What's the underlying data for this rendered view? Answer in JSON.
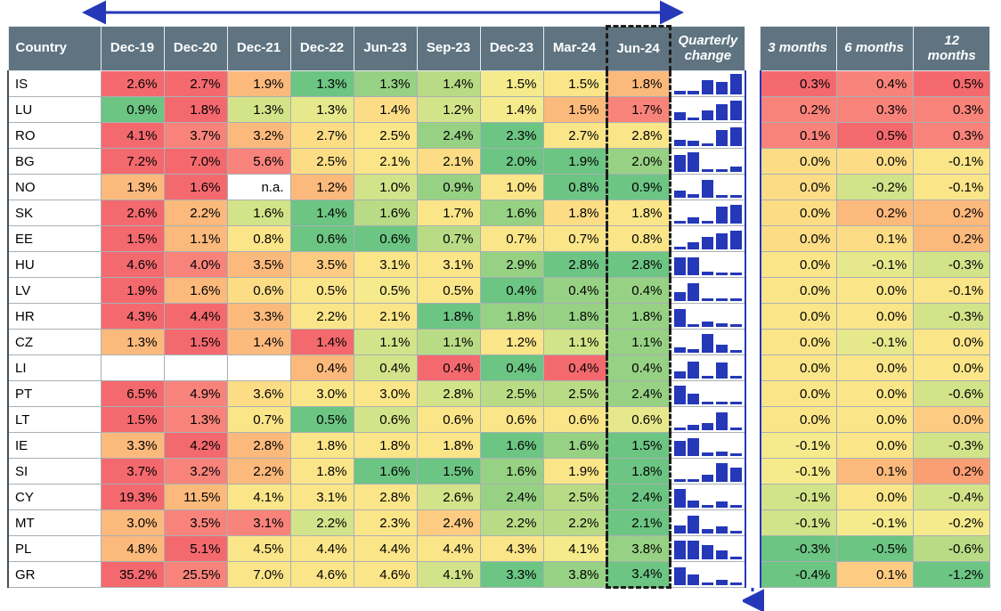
{
  "chart_data": {
    "type": "table",
    "title": "",
    "legend": "",
    "columns": [
      "Country",
      "Dec-19",
      "Dec-20",
      "Dec-21",
      "Dec-22",
      "Jun-23",
      "Sep-23",
      "Dec-23",
      "Mar-24",
      "Jun-24",
      "Quarterly change",
      "3 months",
      "6 months",
      "12 months"
    ],
    "highlighted_column": "Jun-24",
    "annotations": {
      "horizontal_arrow": "double-headed arrow spanning Dec-19 to Jun-24 columns",
      "vertical_arrow": "downward arrow along left edge of 3 months column",
      "arrow_color": "#2438b8"
    },
    "rows": [
      {
        "country": "IS",
        "values": [
          "2.6%",
          "2.7%",
          "1.9%",
          "1.3%",
          "1.3%",
          "1.4%",
          "1.5%",
          "1.5%",
          "1.8%"
        ],
        "spark": [
          4,
          4,
          16,
          14,
          23
        ],
        "changes": [
          "0.3%",
          "0.4%",
          "0.5%"
        ]
      },
      {
        "country": "LU",
        "values": [
          "0.9%",
          "1.8%",
          "1.3%",
          "1.3%",
          "1.4%",
          "1.2%",
          "1.4%",
          "1.5%",
          "1.7%"
        ],
        "spark": [
          9,
          3,
          11,
          18,
          22
        ],
        "changes": [
          "0.2%",
          "0.3%",
          "0.3%"
        ]
      },
      {
        "country": "RO",
        "values": [
          "4.1%",
          "3.7%",
          "3.2%",
          "2.7%",
          "2.5%",
          "2.4%",
          "2.3%",
          "2.7%",
          "2.8%"
        ],
        "spark": [
          7,
          6,
          3,
          18,
          21
        ],
        "changes": [
          "0.1%",
          "0.5%",
          "0.3%"
        ]
      },
      {
        "country": "BG",
        "values": [
          "7.2%",
          "7.0%",
          "5.6%",
          "2.5%",
          "2.1%",
          "2.1%",
          "2.0%",
          "1.9%",
          "2.0%"
        ],
        "spark": [
          19,
          22,
          3,
          3,
          6
        ],
        "changes": [
          "0.0%",
          "0.0%",
          "-0.1%"
        ]
      },
      {
        "country": "NO",
        "values": [
          "1.3%",
          "1.6%",
          "n.a.",
          "1.2%",
          "1.0%",
          "0.9%",
          "1.0%",
          "0.8%",
          "0.9%"
        ],
        "spark": [
          8,
          4,
          20,
          3,
          3
        ],
        "changes": [
          "0.0%",
          "-0.2%",
          "-0.1%"
        ]
      },
      {
        "country": "SK",
        "values": [
          "2.6%",
          "2.2%",
          "1.6%",
          "1.4%",
          "1.6%",
          "1.7%",
          "1.6%",
          "1.8%",
          "1.8%"
        ],
        "spark": [
          3,
          7,
          3,
          19,
          21
        ],
        "changes": [
          "0.0%",
          "0.2%",
          "0.2%"
        ]
      },
      {
        "country": "EE",
        "values": [
          "1.5%",
          "1.1%",
          "0.8%",
          "0.6%",
          "0.6%",
          "0.7%",
          "0.7%",
          "0.7%",
          "0.8%"
        ],
        "spark": [
          3,
          8,
          14,
          18,
          21
        ],
        "changes": [
          "0.0%",
          "0.1%",
          "0.2%"
        ]
      },
      {
        "country": "HU",
        "values": [
          "4.6%",
          "4.0%",
          "3.5%",
          "3.5%",
          "3.1%",
          "3.1%",
          "2.9%",
          "2.8%",
          "2.8%"
        ],
        "spark": [
          20,
          20,
          4,
          3,
          3
        ],
        "changes": [
          "0.0%",
          "-0.1%",
          "-0.3%"
        ]
      },
      {
        "country": "LV",
        "values": [
          "1.9%",
          "1.6%",
          "0.6%",
          "0.5%",
          "0.5%",
          "0.5%",
          "0.4%",
          "0.4%",
          "0.4%"
        ],
        "spark": [
          10,
          20,
          3,
          3,
          3
        ],
        "changes": [
          "0.0%",
          "0.0%",
          "-0.1%"
        ]
      },
      {
        "country": "HR",
        "values": [
          "4.3%",
          "4.4%",
          "3.3%",
          "2.2%",
          "2.1%",
          "1.8%",
          "1.8%",
          "1.8%",
          "1.8%"
        ],
        "spark": [
          20,
          3,
          6,
          4,
          3
        ],
        "changes": [
          "0.0%",
          "0.0%",
          "-0.3%"
        ]
      },
      {
        "country": "CZ",
        "values": [
          "1.3%",
          "1.5%",
          "1.4%",
          "1.4%",
          "1.1%",
          "1.1%",
          "1.2%",
          "1.1%",
          "1.1%"
        ],
        "spark": [
          6,
          4,
          21,
          9,
          3
        ],
        "changes": [
          "0.0%",
          "-0.1%",
          "0.0%"
        ]
      },
      {
        "country": "LI",
        "values": [
          "",
          "",
          "",
          "0.4%",
          "0.4%",
          "0.4%",
          "0.4%",
          "0.4%",
          "0.4%"
        ],
        "spark": [
          8,
          19,
          3,
          18,
          3
        ],
        "changes": [
          "0.0%",
          "0.0%",
          "0.0%"
        ]
      },
      {
        "country": "PT",
        "values": [
          "6.5%",
          "4.9%",
          "3.6%",
          "3.0%",
          "3.0%",
          "2.8%",
          "2.5%",
          "2.5%",
          "2.4%"
        ],
        "spark": [
          21,
          12,
          3,
          3,
          3
        ],
        "changes": [
          "0.0%",
          "0.0%",
          "-0.6%"
        ]
      },
      {
        "country": "LT",
        "values": [
          "1.5%",
          "1.3%",
          "0.7%",
          "0.5%",
          "0.6%",
          "0.6%",
          "0.6%",
          "0.6%",
          "0.6%"
        ],
        "spark": [
          3,
          6,
          8,
          20,
          3
        ],
        "changes": [
          "0.0%",
          "0.0%",
          "0.0%"
        ]
      },
      {
        "country": "IE",
        "values": [
          "3.3%",
          "4.2%",
          "2.8%",
          "1.8%",
          "1.8%",
          "1.8%",
          "1.6%",
          "1.6%",
          "1.5%"
        ],
        "spark": [
          17,
          20,
          4,
          5,
          3
        ],
        "changes": [
          "-0.1%",
          "0.0%",
          "-0.3%"
        ]
      },
      {
        "country": "SI",
        "values": [
          "3.7%",
          "3.2%",
          "2.2%",
          "1.8%",
          "1.6%",
          "1.5%",
          "1.6%",
          "1.9%",
          "1.8%"
        ],
        "spark": [
          3,
          3,
          8,
          21,
          16
        ],
        "changes": [
          "-0.1%",
          "0.1%",
          "0.2%"
        ]
      },
      {
        "country": "CY",
        "values": [
          "19.3%",
          "11.5%",
          "4.1%",
          "3.1%",
          "2.8%",
          "2.6%",
          "2.4%",
          "2.5%",
          "2.4%"
        ],
        "spark": [
          21,
          8,
          3,
          7,
          3
        ],
        "changes": [
          "-0.1%",
          "0.0%",
          "-0.4%"
        ]
      },
      {
        "country": "MT",
        "values": [
          "3.0%",
          "3.5%",
          "3.1%",
          "2.2%",
          "2.3%",
          "2.4%",
          "2.2%",
          "2.2%",
          "2.1%"
        ],
        "spark": [
          9,
          20,
          5,
          8,
          3
        ],
        "changes": [
          "-0.1%",
          "-0.1%",
          "-0.2%"
        ]
      },
      {
        "country": "PL",
        "values": [
          "4.8%",
          "5.1%",
          "4.5%",
          "4.4%",
          "4.4%",
          "4.4%",
          "4.3%",
          "4.1%",
          "3.8%"
        ],
        "spark": [
          21,
          21,
          16,
          10,
          3
        ],
        "changes": [
          "-0.3%",
          "-0.5%",
          "-0.6%"
        ]
      },
      {
        "country": "GR",
        "values": [
          "35.2%",
          "25.5%",
          "7.0%",
          "4.6%",
          "4.6%",
          "4.1%",
          "3.3%",
          "3.8%",
          "3.4%"
        ],
        "spark": [
          20,
          12,
          3,
          6,
          3
        ],
        "changes": [
          "-0.4%",
          "0.1%",
          "-1.2%"
        ]
      }
    ],
    "cell_colors": [
      [
        "w",
        "r1",
        "r1",
        "o1",
        "g4",
        "g3",
        "g2",
        "y3",
        "y2",
        "o1"
      ],
      [
        "w",
        "g4",
        "r1",
        "g1",
        "yg",
        "y1",
        "g1",
        "y3",
        "o1",
        "r2"
      ],
      [
        "w",
        "r1",
        "r2",
        "o1",
        "y1",
        "y2",
        "g3",
        "g4",
        "y2",
        "y2"
      ],
      [
        "w",
        "r1",
        "r1",
        "r2",
        "y1",
        "y2",
        "y1",
        "g4",
        "g4",
        "g3"
      ],
      [
        "w",
        "o1",
        "r1",
        "w",
        "o1",
        "g1",
        "g3",
        "y2",
        "g4",
        "g4"
      ],
      [
        "w",
        "r1",
        "o1",
        "g1",
        "g4",
        "g2",
        "y2",
        "g3",
        "y1",
        "y2"
      ],
      [
        "w",
        "r1",
        "o1",
        "y2",
        "g4",
        "g4",
        "g2",
        "y2",
        "y2",
        "y2"
      ],
      [
        "w",
        "r1",
        "r2",
        "o1",
        "o2",
        "y2",
        "y2",
        "g3",
        "g4",
        "g4"
      ],
      [
        "w",
        "r1",
        "o1",
        "y1",
        "y2",
        "y3",
        "y2",
        "g4",
        "g3",
        "g3"
      ],
      [
        "w",
        "r1",
        "r1",
        "o1",
        "y2",
        "y2",
        "g4",
        "g3",
        "g3",
        "g3"
      ],
      [
        "w",
        "o1",
        "r1",
        "o1",
        "r1",
        "g1",
        "g2",
        "y2",
        "g1",
        "g3"
      ],
      [
        "w",
        "w",
        "w",
        "w",
        "o1",
        "g1",
        "r1",
        "g4",
        "r1",
        "g3"
      ],
      [
        "w",
        "r1",
        "r2",
        "y1",
        "y2",
        "y2",
        "g1",
        "g2",
        "g2",
        "g3"
      ],
      [
        "w",
        "r1",
        "r2",
        "y2",
        "g4",
        "g1",
        "y2",
        "y2",
        "y2",
        "yg"
      ],
      [
        "w",
        "o1",
        "r1",
        "o1",
        "y2",
        "y2",
        "y2",
        "g4",
        "g3",
        "g4"
      ],
      [
        "w",
        "r1",
        "r2",
        "o1",
        "y2",
        "g4",
        "g4",
        "g3",
        "y2",
        "g4"
      ],
      [
        "w",
        "r1",
        "o1",
        "y2",
        "y2",
        "y2",
        "g1",
        "g3",
        "g2",
        "g4"
      ],
      [
        "w",
        "o1",
        "r2",
        "r2",
        "g1",
        "y2",
        "o2",
        "g2",
        "g2",
        "g4"
      ],
      [
        "w",
        "o1",
        "r1",
        "y2",
        "y2",
        "y2",
        "y2",
        "y2",
        "y3",
        "g3"
      ],
      [
        "w",
        "r1",
        "r2",
        "y2",
        "y2",
        "y2",
        "g1",
        "g4",
        "g3",
        "g4"
      ]
    ],
    "change_colors": [
      [
        "r1",
        "r2",
        "r1"
      ],
      [
        "r2",
        "r2",
        "r2"
      ],
      [
        "r2",
        "r1",
        "r2"
      ],
      [
        "y1",
        "y1",
        "y2"
      ],
      [
        "y1",
        "g1",
        "y2"
      ],
      [
        "y1",
        "o1",
        "o1"
      ],
      [
        "y1",
        "y1",
        "o1"
      ],
      [
        "y2",
        "yg",
        "g1"
      ],
      [
        "y2",
        "y2",
        "y2"
      ],
      [
        "y2",
        "y2",
        "g1"
      ],
      [
        "y2",
        "yg",
        "y2"
      ],
      [
        "y2",
        "y2",
        "y2"
      ],
      [
        "y2",
        "y2",
        "g1"
      ],
      [
        "y2",
        "y2",
        "o2"
      ],
      [
        "y3",
        "y2",
        "g1"
      ],
      [
        "y3",
        "o1",
        "r3"
      ],
      [
        "g1",
        "y2",
        "g1"
      ],
      [
        "g1",
        "y3",
        "y3"
      ],
      [
        "g4",
        "g4",
        "g2"
      ],
      [
        "g4",
        "o2",
        "g4"
      ]
    ]
  },
  "header": {
    "country_label": "Country",
    "periods": [
      "Dec-19",
      "Dec-20",
      "Dec-21",
      "Dec-22",
      "Jun-23",
      "Sep-23",
      "Dec-23",
      "Mar-24",
      "Jun-24"
    ],
    "quarterly_change_label": "Quarterly change",
    "three_months_label": "3 months",
    "six_months_label": "6 months",
    "twelve_months_label": "12 months"
  }
}
